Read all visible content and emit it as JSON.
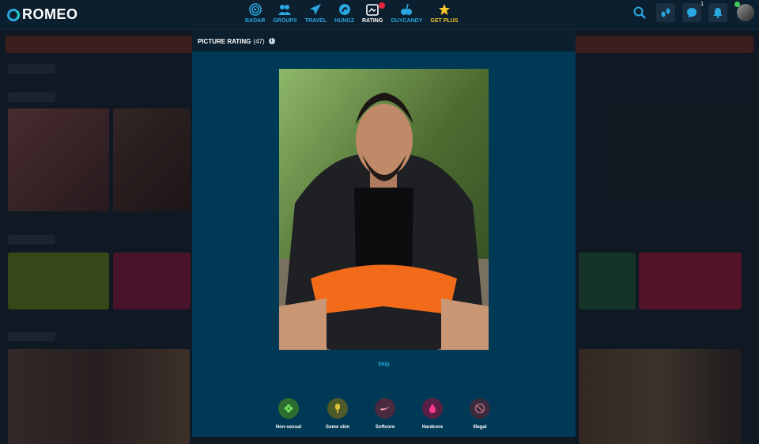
{
  "app": {
    "logo_text": "ROMEO"
  },
  "nav": [
    {
      "id": "radar",
      "label": "RADAR",
      "icon": "radar-icon"
    },
    {
      "id": "groups",
      "label": "GROUPS",
      "icon": "groups-icon"
    },
    {
      "id": "travel",
      "label": "TRAVEL",
      "icon": "plane-icon"
    },
    {
      "id": "hungz",
      "label": "HUNGZ",
      "icon": "hungz-icon"
    },
    {
      "id": "rating",
      "label": "RATING",
      "icon": "rating-icon",
      "active": true
    },
    {
      "id": "guycandy",
      "label": "GUYCANDY",
      "icon": "candy-icon"
    },
    {
      "id": "getplus",
      "label": "GET PLUS",
      "icon": "star-icon"
    }
  ],
  "tools": {
    "messages_count": "1"
  },
  "modal": {
    "title": "PICTURE RATING",
    "count": "(47)",
    "info": "i",
    "skip": "Skip",
    "ratings": [
      {
        "label": "Non-sexual",
        "icon": "flower-icon",
        "bg": "#2e6b2f",
        "fg": "#6be05a"
      },
      {
        "label": "Some skin",
        "icon": "popsicle-icon",
        "bg": "#4e5a2a",
        "fg": "#e0c23a"
      },
      {
        "label": "Softcore",
        "icon": "swoosh-icon",
        "bg": "#4a2a3e",
        "fg": "#f0a0b0"
      },
      {
        "label": "Hardcore",
        "icon": "drop-icon",
        "bg": "#5a1f45",
        "fg": "#ff3a8a"
      },
      {
        "label": "Illegal",
        "icon": "ban-icon",
        "bg": "#3a2a3e",
        "fg": "#b0687a"
      }
    ]
  },
  "colors": {
    "accent": "#2aa7e0",
    "plus": "#f6c62b",
    "modal_bg": "#003955",
    "header_bg": "#0c1f2e"
  }
}
